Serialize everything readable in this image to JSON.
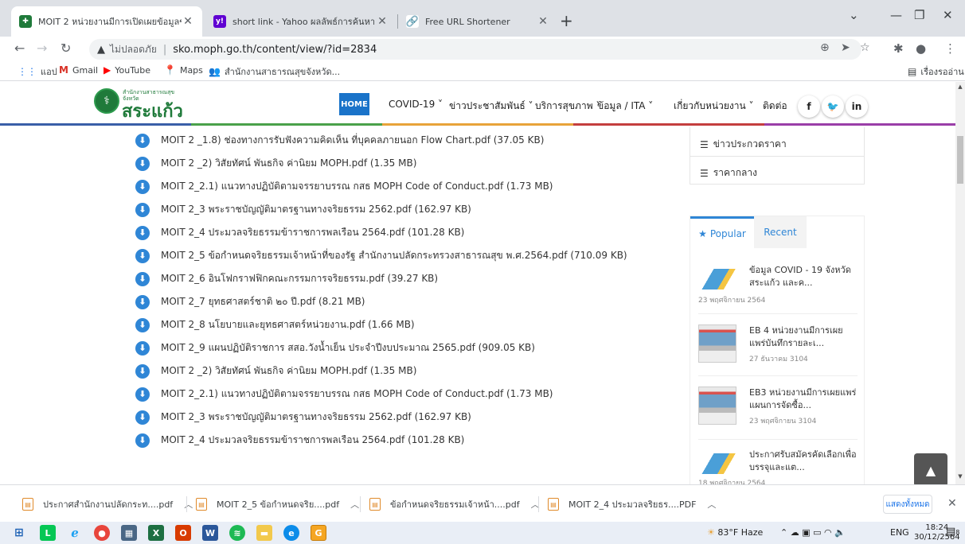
{
  "browser": {
    "tabs": [
      {
        "title": "MOIT 2 หน่วยงานมีการเปิดเผยข้อมูลข่าวสารฯ",
        "active": true
      },
      {
        "title": "short link - Yahoo ผลลัพธ์การค้นหา",
        "active": false
      },
      {
        "title": "Free URL Shortener",
        "active": false
      }
    ],
    "address": {
      "security_label": "ไม่ปลอดภัย",
      "url": "sko.moph.go.th/content/view/?id=2834"
    },
    "bookmarks": [
      "แอป",
      "Gmail",
      "YouTube",
      "Maps",
      "สำนักงานสาธารณสุขจังหวัด..."
    ],
    "reading_list": "เรื่องรออ่าน"
  },
  "site": {
    "logo_small": "สำนักงานสาธารณสุข",
    "logo_small2": "จังหวัด",
    "logo_big": "สระแก้ว",
    "nav": {
      "home": "HOME",
      "items": [
        "COVID-19 ˅",
        "ข่าวประชาสัมพันธ์ ˅",
        "บริการสุขภาพ ˅",
        "ข้อมูล / ITA ˅",
        "เกี่ยวกับหน่วยงาน ˅",
        "ติดต่อ"
      ]
    },
    "social": [
      "f",
      "🐦",
      "in"
    ]
  },
  "files": [
    "MOIT 2 _1.8) ช่องทางการรับฟังความคิดเห็น ที่บุคคลภายนอก Flow Chart.pdf (37.05 KB)",
    "MOIT 2 _2) วิสัยทัศน์ พันธกิจ ค่านิยม MOPH.pdf (1.35 MB)",
    "MOIT 2_2.1) แนวทางปฏิบัติตามจรรยาบรรณ กสธ MOPH Code of Conduct.pdf (1.73 MB)",
    "MOIT 2_3 พระราชบัญญัติมาตรฐานทางจริยธรรม 2562.pdf (162.97 KB)",
    "MOIT 2_4 ประมวลจริยธรรมข้าราชการพลเรือน 2564.pdf (101.28 KB)",
    "MOIT 2_5 ข้อกำหนดจริยธรรมเจ้าหน้าที่ของรัฐ สำนักงานปลัดกระทรวงสาธารณสุข พ.ศ.2564.pdf (710.09 KB)",
    "MOIT 2_6 อินโฟกราฟฟิกคณะกรรมการจริยธรรม.pdf (39.27 KB)",
    "MOIT 2_7 ยุทธศาสตร์ชาติ ๒๐ ปี.pdf (8.21 MB)",
    "MOIT 2_8 นโยบายและยุทธศาสตร์หน่วยงาน.pdf (1.66 MB)",
    "MOIT 2_9 แผนปฏิบัติราชการ สสอ.วังน้ำเย็น ประจำปีงบประมาณ 2565.pdf (909.05 KB)",
    "MOIT 2 _2) วิสัยทัศน์ พันธกิจ ค่านิยม MOPH.pdf (1.35 MB)",
    "MOIT 2_2.1) แนวทางปฏิบัติตามจรรยาบรรณ กสธ MOPH Code of Conduct.pdf (1.73 MB)",
    "MOIT 2_3 พระราชบัญญัติมาตรฐานทางจริยธรรม 2562.pdf (162.97 KB)",
    "MOIT 2_4 ประมวลจริยธรรมข้าราชการพลเรือน 2564.pdf (101.28 KB)"
  ],
  "sidebar": {
    "menu": [
      "ข่าวประกวดราคา",
      "ราคากลาง"
    ],
    "tabs": {
      "popular": "Popular",
      "recent": "Recent"
    },
    "posts": [
      {
        "title": "ข้อมูล COVID - 19 จังหวัดสระแก้ว และค...",
        "date": "23 พฤศจิกายน 2564"
      },
      {
        "title": "EB 4 หน่วยงานมีการเผยแพร่บันทึกรายละเ...",
        "date": "27 ธันวาคม 3104"
      },
      {
        "title": "EB3 หน่วยงานมีการเผยแพร่แผนการจัดซื้อ...",
        "date": "23 พฤศจิกายน 3104"
      },
      {
        "title": "ประกาศรับสมัครคัดเลือกเพื่อบรรจุและแต...",
        "date": "18 พฤศจิกายน 2564"
      }
    ]
  },
  "downloads": {
    "items": [
      "ประกาศสำนักงานปลัดกระท....pdf",
      "MOIT 2_5 ข้อกำหนดจริย....pdf",
      "ข้อกำหนดจริยธรรมเจ้าหน้า....pdf",
      "MOIT 2_4 ประมวลจริยธร....PDF"
    ],
    "show_all": "แสดงทั้งหมด"
  },
  "taskbar": {
    "weather": "83°F Haze",
    "lang": "ENG",
    "time": "18:24",
    "date": "30/12/2564",
    "notif_count": "8"
  },
  "colors": {
    "accent": "#2f86d6",
    "home_bg": "#1a73c9",
    "logo_green": "#1f7a3a"
  }
}
